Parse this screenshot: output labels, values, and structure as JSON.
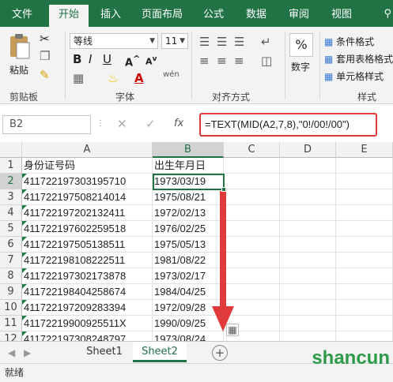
{
  "tabs": [
    "文件",
    "开始",
    "插入",
    "页面布局",
    "公式",
    "数据",
    "审阅",
    "视图"
  ],
  "ribbon": {
    "paste_label": "粘贴",
    "clipboard_group": "剪贴板",
    "font_name": "等线",
    "font_size": "11",
    "font_group": "字体",
    "wen_glyph": "wén",
    "align_group": "对齐方式",
    "number_label": "数字",
    "cond_format": "条件格式",
    "table_format": "套用表格格式",
    "cell_style": "单元格样式",
    "style_group": "样式"
  },
  "formula_bar": {
    "name_box": "B2",
    "fx": "fx",
    "formula": "=TEXT(MID(A2,7,8),\"0!/00!/00\")"
  },
  "grid": {
    "columns": [
      "A",
      "B",
      "C",
      "D",
      "E"
    ],
    "row_numbers": [
      "1",
      "2",
      "3",
      "4",
      "5",
      "6",
      "7",
      "8",
      "9",
      "10",
      "11",
      "12"
    ],
    "rows": [
      [
        "身份证号码",
        "出生年月日"
      ],
      [
        "411722197303195710",
        "1973/03/19"
      ],
      [
        "411722197508214014",
        "1975/08/21"
      ],
      [
        "411722197202132411",
        "1972/02/13"
      ],
      [
        "411722197602259518",
        "1976/02/25"
      ],
      [
        "411722197505138511",
        "1975/05/13"
      ],
      [
        "411722198108222511",
        "1981/08/22"
      ],
      [
        "411722197302173878",
        "1973/02/17"
      ],
      [
        "411722198404258674",
        "1984/04/25"
      ],
      [
        "411722197209283394",
        "1972/09/28"
      ],
      [
        "41172219900925511X",
        "1990/09/25"
      ],
      [
        "411722197308248797",
        "1973/08/24"
      ]
    ]
  },
  "sheets": [
    "Sheet1",
    "Sheet2"
  ],
  "active_sheet": "Sheet2",
  "status": "就绪",
  "watermark": "shancun",
  "colors": {
    "accent": "#217346",
    "annotation": "#e03a3a"
  }
}
